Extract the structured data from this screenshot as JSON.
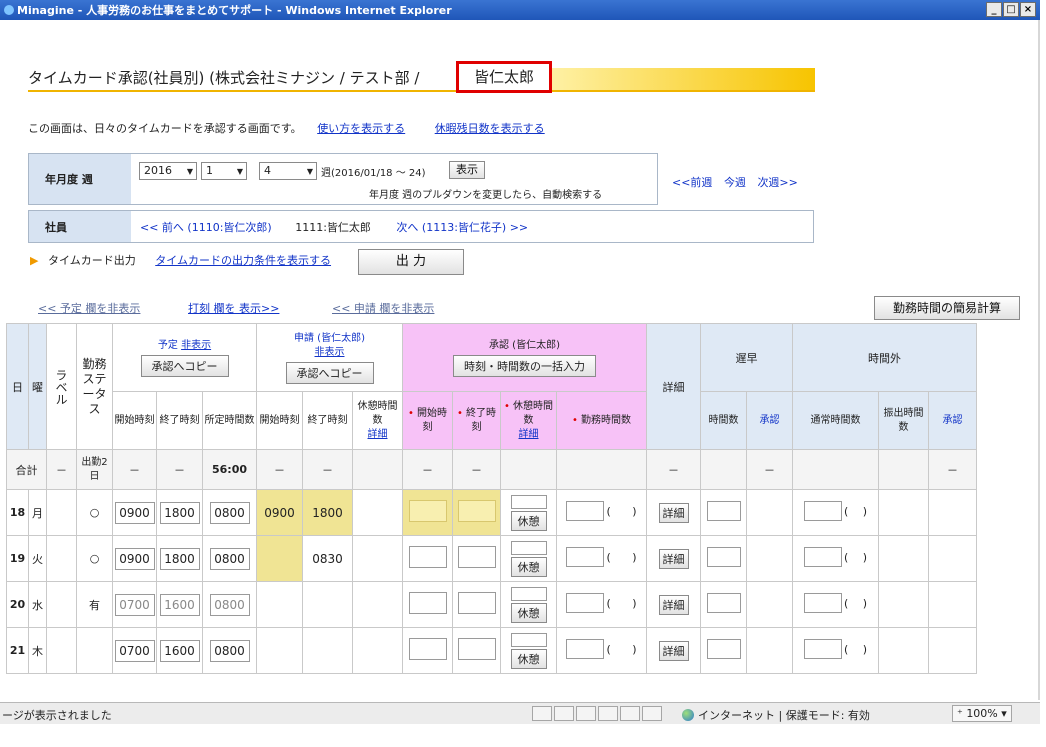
{
  "window": {
    "title": "Minagine - 人事労務のお仕事をまとめてサポート - Windows Internet Explorer",
    "min": "_",
    "max": "□",
    "close": "×"
  },
  "page": {
    "title": "タイムカード承認(社員別) (株式会社ミナジン / テスト部 / ",
    "title_name": "皆仁太郎",
    "intro": "この画面は、日々のタイムカードを承認する画面です。",
    "link_usage": "使い方を表示する",
    "link_leave": "休暇残日数を表示する"
  },
  "period": {
    "label": "年月度 週",
    "year": "2016",
    "month": "1",
    "week": "4",
    "week_range": "週(2016/01/18 ～ 24)",
    "show_button": "表示",
    "hint": "年月度 週のプルダウンを変更したら、自動検索する",
    "nav_prev": "<<前週",
    "nav_this": "今週",
    "nav_next": "次週>>"
  },
  "employee": {
    "label": "社員",
    "prev": "<< 前へ (1110:皆仁次郎)",
    "current": "1111:皆仁太郎",
    "next": "次へ (1113:皆仁花子) >>"
  },
  "timecard_output": {
    "label": "タイムカード出力",
    "link": "タイムカードの出力条件を表示する",
    "button": "出 力"
  },
  "toggles": {
    "hide_plan": "<< 予定 欄を非表示",
    "show_stamp": "打刻 欄を 表示>>",
    "hide_request": "<< 申請 欄を非表示"
  },
  "simple_calc_button": "勤務時間の簡易計算",
  "grid": {
    "h_day": "日",
    "h_dow": "曜",
    "h_label": "ラベル",
    "h_status": "勤務ステータス",
    "plan_title": "予定",
    "plan_link": "非表示",
    "plan_copy": "承認へコピー",
    "req_title": "申請 (皆仁太郎)",
    "req_link": "非表示",
    "req_copy": "承認へコピー",
    "appr_title": "承認 (皆仁太郎)",
    "appr_bulk": "時刻・時間数の一括入力",
    "h_detail": "詳細",
    "h_late": "遅早",
    "h_overtime": "時間外",
    "c_start": "開始時刻",
    "c_end": "終了時刻",
    "c_sched": "所定時間数",
    "c_break": "休憩時間数",
    "c_break_link": "詳細",
    "c_work": "勤務時間数",
    "c_hours": "時間数",
    "c_appr": "承認",
    "c_normal": "通常時間数",
    "c_transfer": "振出時間数",
    "star": "•",
    "total_label": "合計",
    "total_dash": "－",
    "total_status": "出勤2日",
    "total_sched": "56:00",
    "break_btn": "休憩",
    "detail_btn": "詳細",
    "paren_open": "(",
    "paren_close": ")",
    "rows": [
      {
        "day": "18",
        "dow": "月",
        "status": "○",
        "p_start": "0900",
        "p_end": "1800",
        "p_sched": "0800",
        "r_start": "0900",
        "r_end": "1800"
      },
      {
        "day": "19",
        "dow": "火",
        "status": "○",
        "p_start": "0900",
        "p_end": "1800",
        "p_sched": "0800",
        "r_start": "",
        "r_end": "0830"
      },
      {
        "day": "20",
        "dow": "水",
        "status": "有",
        "p_start": "0700",
        "p_end": "1600",
        "p_sched": "0800",
        "r_start": "",
        "r_end": ""
      },
      {
        "day": "21",
        "dow": "木",
        "status": "",
        "p_start": "0700",
        "p_end": "1600",
        "p_sched": "0800",
        "r_start": "",
        "r_end": ""
      }
    ]
  },
  "statusbar": {
    "text": "ージが表示されました",
    "zone": "インターネット | 保護モード: 有効",
    "zoom": "100%"
  }
}
